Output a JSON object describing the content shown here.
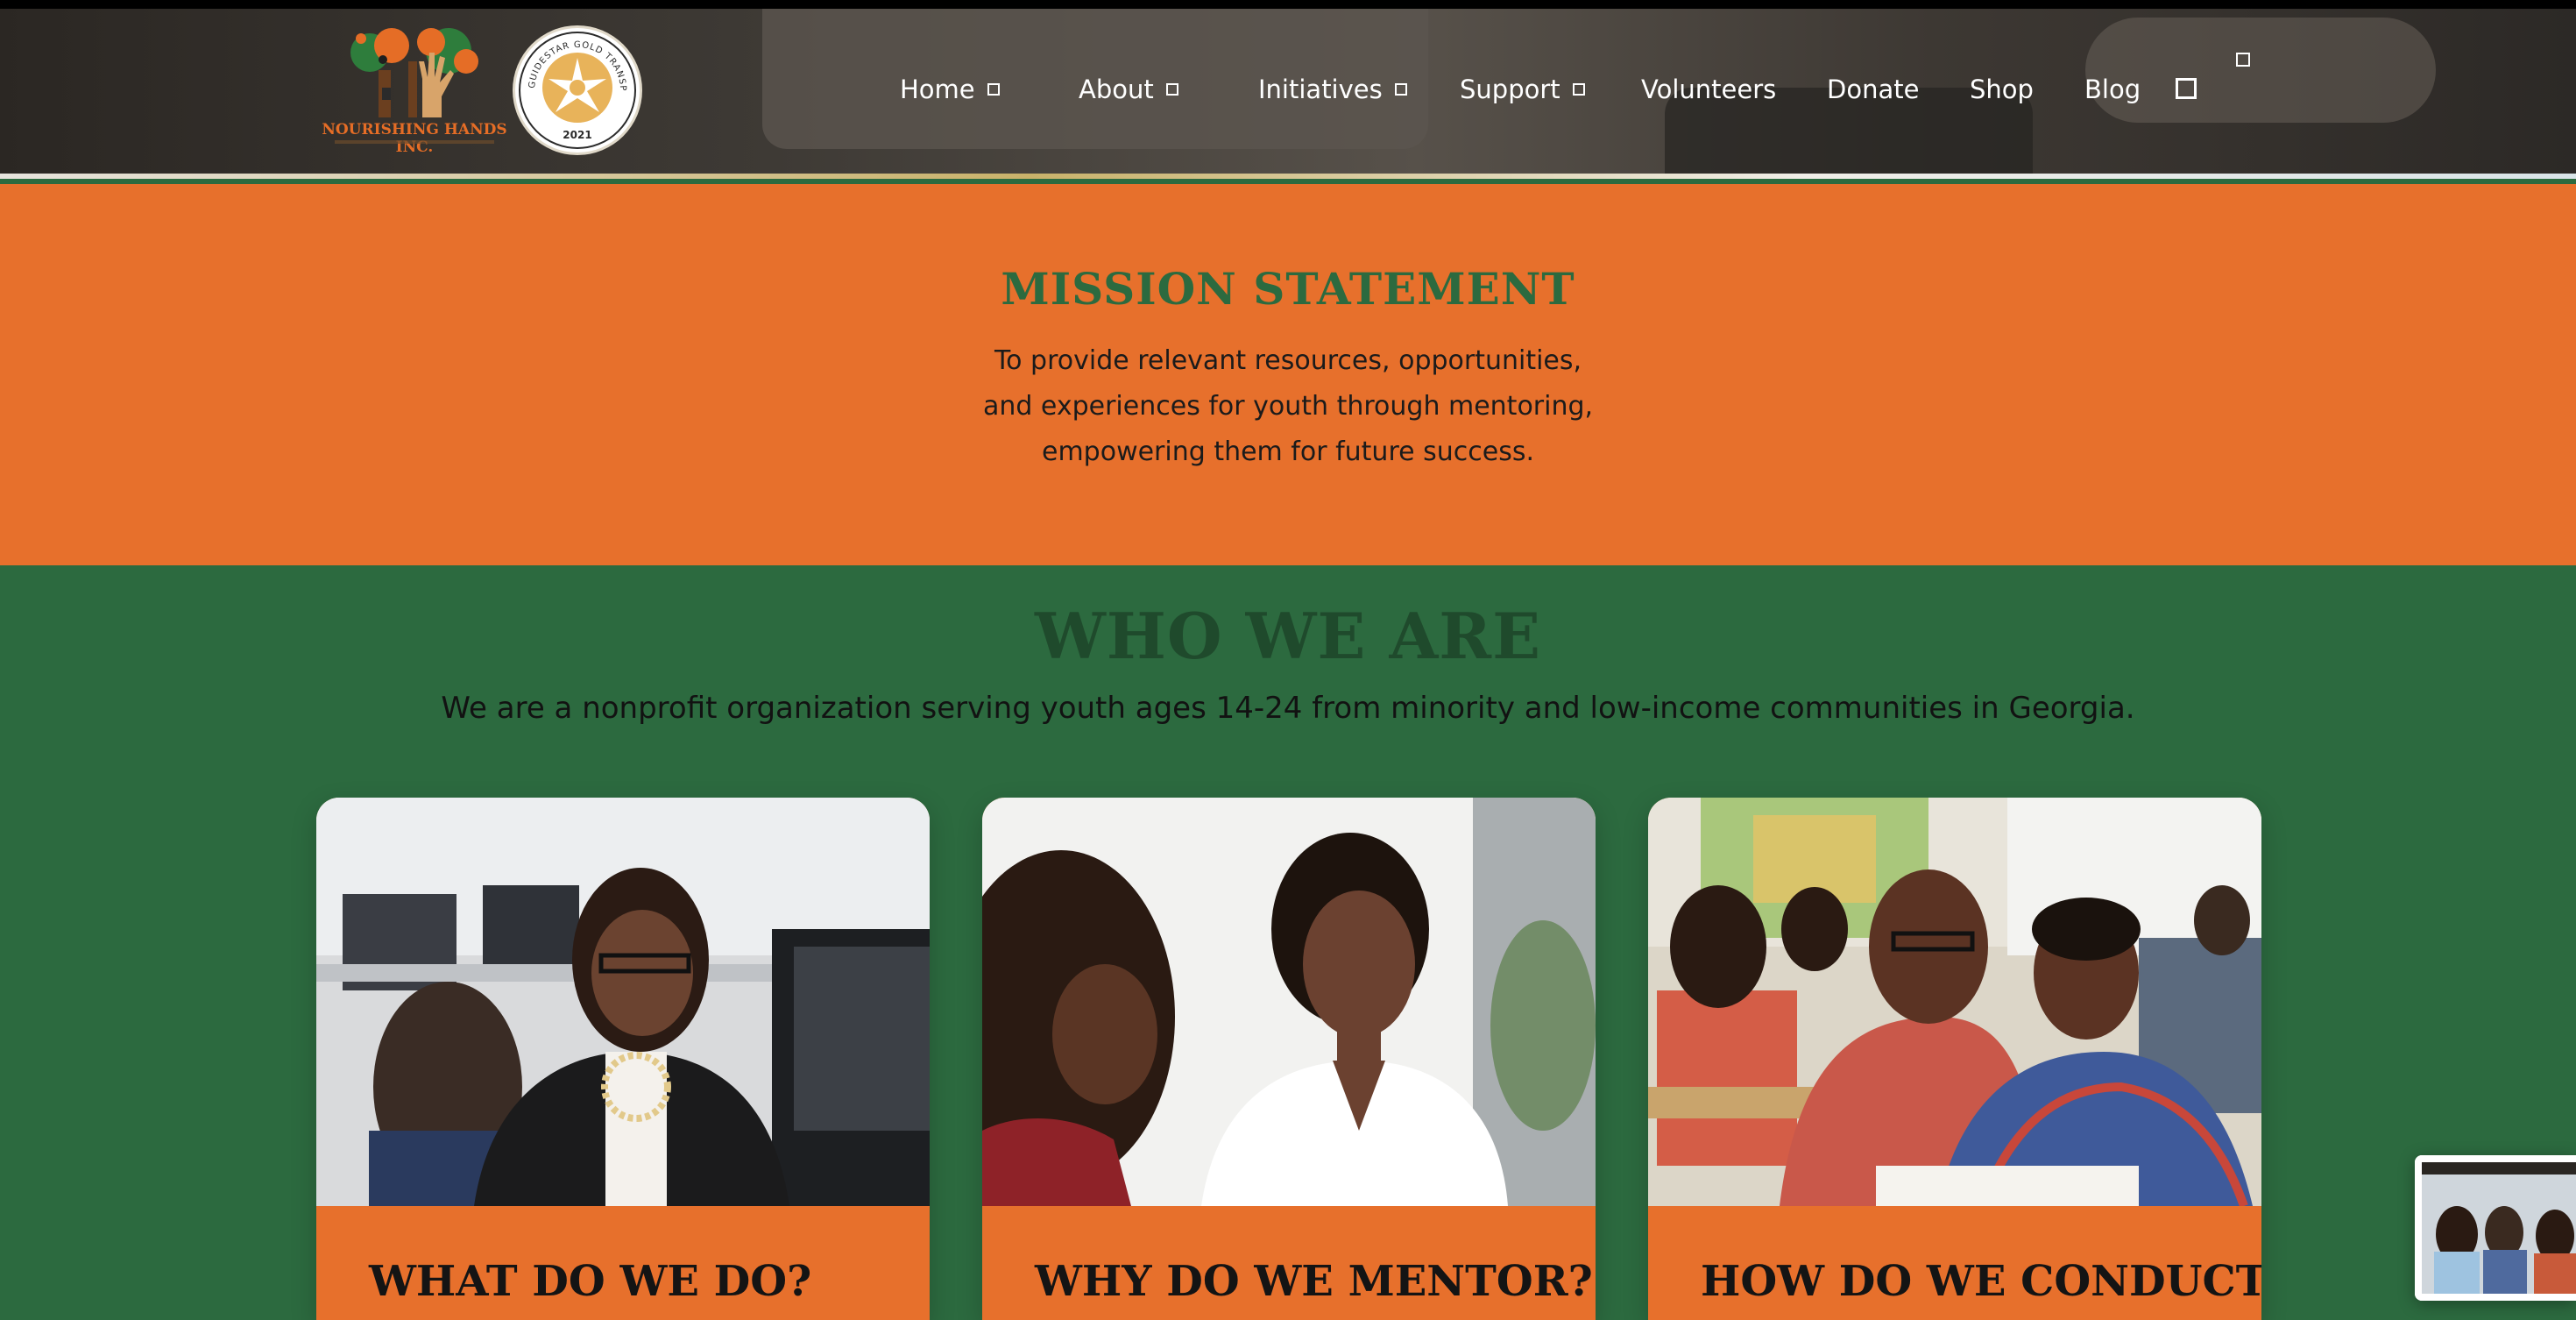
{
  "header": {
    "logo_name": "NOURISHING HANDS INC.",
    "seal_text": "GUIDESTAR GOLD TRANSPARENCY",
    "seal_year": "2021",
    "nav": [
      {
        "label": "Home",
        "has_dropdown": true
      },
      {
        "label": "About",
        "has_dropdown": true
      },
      {
        "label": "Initiatives",
        "has_dropdown": true
      },
      {
        "label": "Support",
        "has_dropdown": true
      },
      {
        "label": "Volunteers",
        "has_dropdown": false
      },
      {
        "label": "Donate",
        "has_dropdown": false
      },
      {
        "label": "Shop",
        "has_dropdown": false
      },
      {
        "label": "Blog",
        "has_dropdown": false
      }
    ]
  },
  "mission": {
    "title": "MISSION STATEMENT",
    "line1": "To provide relevant resources, opportunities,",
    "line2": "and experiences for youth through mentoring,",
    "line3": "empowering them for future success."
  },
  "who": {
    "title": "WHO WE ARE",
    "intro": "We are a nonprofit organization serving youth ages 14-24 from minority and low-income communities in Georgia."
  },
  "cards": [
    {
      "title": "WHAT DO WE DO?"
    },
    {
      "title": "WHY DO WE MENTOR?"
    },
    {
      "title": "HOW DO WE CONDUCT"
    }
  ],
  "colors": {
    "orange": "#e7702c",
    "green": "#2c6a3f",
    "dark_green_heading": "#1f4a2c"
  }
}
